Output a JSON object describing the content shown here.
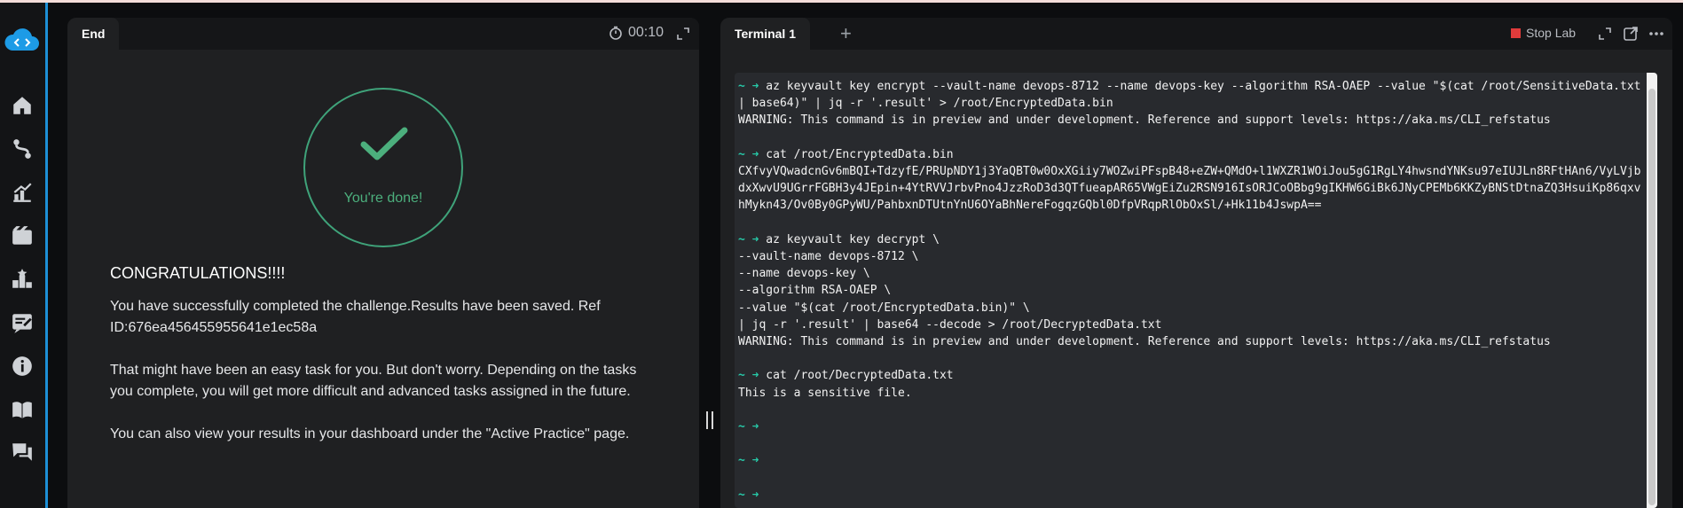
{
  "sidebar": {
    "items": [
      {
        "icon": "home-icon"
      },
      {
        "icon": "route-icon"
      },
      {
        "icon": "chart-icon"
      },
      {
        "icon": "film-icon"
      },
      {
        "icon": "ranking-icon"
      },
      {
        "icon": "notes-icon"
      },
      {
        "icon": "info-icon"
      },
      {
        "icon": "book-icon"
      },
      {
        "icon": "chat-icon"
      }
    ]
  },
  "left_panel": {
    "tab_label": "End",
    "timer": "00:10",
    "done_text": "You're done!",
    "congrats_title": "CONGRATULATIONS!!!!",
    "paragraphs": [
      "You have successfully completed the challenge.Results have been saved. Ref ID:676ea456455955641e1ec58a",
      "That might have been an easy task for you. But don't worry. Depending on the tasks you complete, you will get more difficult and advanced tasks assigned in the future.",
      "You can also view your results in your dashboard under the \"Active Practice\" page."
    ]
  },
  "right_panel": {
    "tab_label": "Terminal 1",
    "add_tab": "+",
    "stop_lab_label": "Stop Lab",
    "terminal": {
      "prompt": "~ ➜",
      "blocks": [
        {
          "cmd": "az keyvault key encrypt --vault-name devops-8712 --name devops-key --algorithm RSA-OAEP --value \"$(cat /root/SensitiveData.txt | base64)\" | jq -r '.result' > /root/EncryptedData.bin",
          "output": [
            "WARNING: This command is in preview and under development. Reference and support levels: https://aka.ms/CLI_refstatus"
          ]
        },
        {
          "cmd": "cat /root/EncryptedData.bin",
          "output": [
            "CXfvyVQwadcnGv6mBQI+TdzyfE/PRUpNDY1j3YaQBT0w0OxXGiiy7WOZwiPFspB48+eZW+QMdO+l1WXZR1WOiJou5gG1RgLY4hwsndYNKsu97eIUJLn8RFtHAn6/VyLVjbdxXwvU9UGrrFGBH3y4JEpin+4YtRVVJrbvPno4JzzRoD3d3QTfueapAR65VWgEiZu2RSN916IsORJCoOBbg9gIKHW6GiBk6JNyCPEMb6KKZyBNStDtnaZQ3HsuiKp86qxvhMykn43/Ov0By0GPyWU/PahbxnDTUtnYnU6OYaBhNereFogqzGQbl0DfpVRqpRlObOxSl/+Hk11b4JswpA=="
          ]
        },
        {
          "cmd": "az keyvault key decrypt \\",
          "output": [
            "--vault-name devops-8712 \\",
            "--name devops-key \\",
            "--algorithm RSA-OAEP \\",
            "--value \"$(cat /root/EncryptedData.bin)\" \\",
            "| jq -r '.result' | base64 --decode > /root/DecryptedData.txt",
            "WARNING: This command is in preview and under development. Reference and support levels: https://aka.ms/CLI_refstatus"
          ]
        },
        {
          "cmd": "cat /root/DecryptedData.txt",
          "output": [
            "This is a sensitive file."
          ]
        },
        {
          "cmd": "",
          "output": []
        },
        {
          "cmd": "",
          "output": []
        },
        {
          "cmd": "",
          "output": []
        }
      ]
    }
  },
  "colors": {
    "accent_blue": "#1d8fd6",
    "success_green": "#4caf7d",
    "prompt_teal": "#27c9a8",
    "stop_red": "#e03b3b"
  }
}
